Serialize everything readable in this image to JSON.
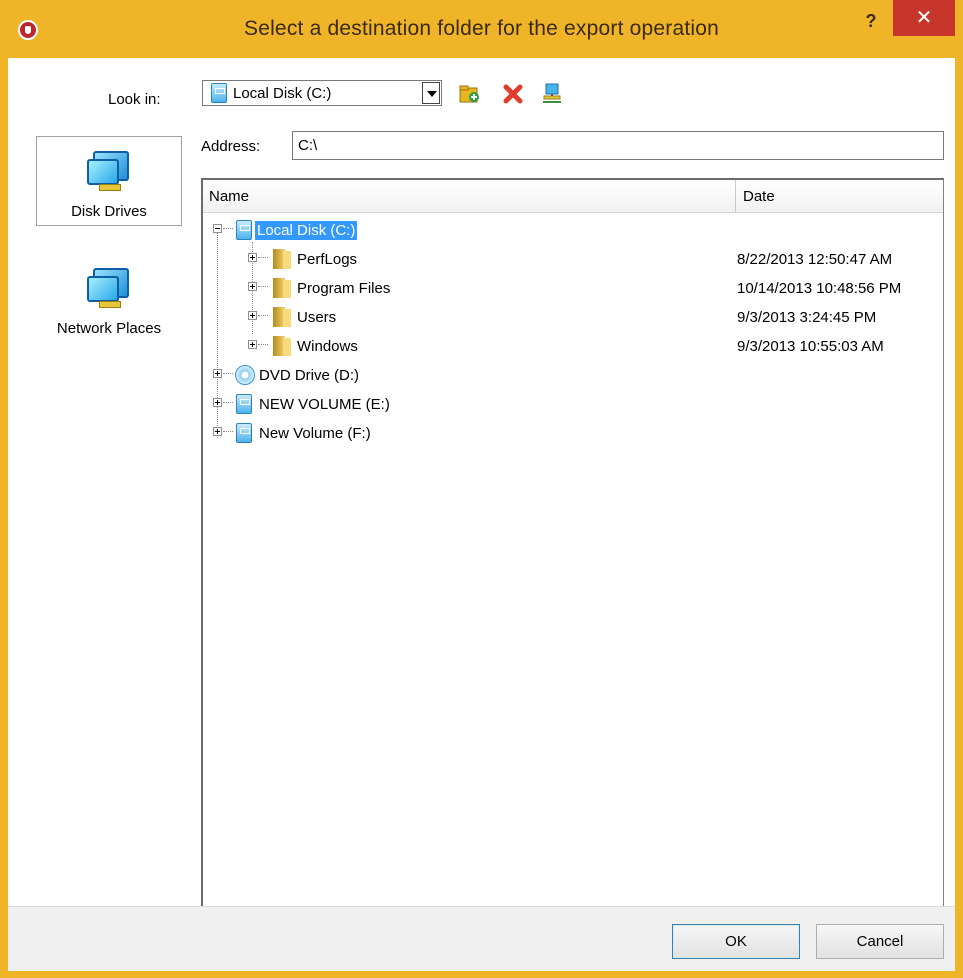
{
  "window": {
    "title": "Select a destination folder for the export operation",
    "help": "?",
    "close": "✕"
  },
  "lookin": {
    "label": "Look in:",
    "value": "Local Disk (C:)"
  },
  "toolbar": {
    "icons": [
      "new-folder-icon",
      "delete-icon",
      "network-icon"
    ]
  },
  "places": {
    "disk_drives": "Disk Drives",
    "network_places": "Network Places"
  },
  "address": {
    "label": "Address:",
    "value": "C:\\"
  },
  "list": {
    "columns": {
      "name": "Name",
      "date": "Date"
    },
    "rows": [
      {
        "name": "Local Disk (C:)",
        "date": "",
        "type": "drive",
        "level": 0,
        "expanded": true,
        "selected": true
      },
      {
        "name": "PerfLogs",
        "date": "8/22/2013 12:50:47 AM",
        "type": "folder",
        "level": 1
      },
      {
        "name": "Program Files",
        "date": "10/14/2013 10:48:56 PM",
        "type": "folder",
        "level": 1
      },
      {
        "name": "Users",
        "date": "9/3/2013 3:24:45 PM",
        "type": "folder",
        "level": 1
      },
      {
        "name": "Windows",
        "date": "9/3/2013 10:55:03 AM",
        "type": "folder",
        "level": 1
      },
      {
        "name": "DVD Drive (D:)",
        "date": "",
        "type": "dvd",
        "level": 0
      },
      {
        "name": "NEW VOLUME (E:)",
        "date": "",
        "type": "drive",
        "level": 0
      },
      {
        "name": "New Volume (F:)",
        "date": "",
        "type": "drive",
        "level": 0
      }
    ]
  },
  "buttons": {
    "ok": "OK",
    "cancel": "Cancel"
  },
  "colors": {
    "titlebar": "#f0b429",
    "close": "#c7362a",
    "selection": "#3399ff"
  }
}
